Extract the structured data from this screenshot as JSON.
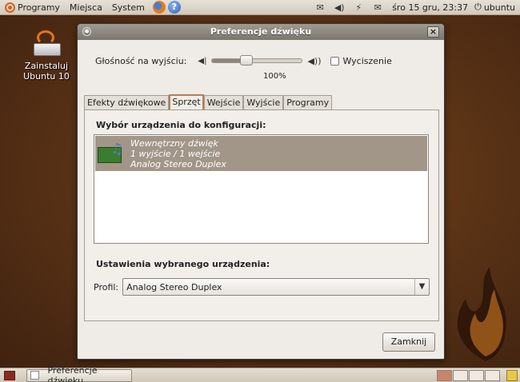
{
  "top_panel": {
    "menus": [
      "Programy",
      "Miejsca",
      "System"
    ],
    "clock": "śro 15 gru, 23:37",
    "user": "ubuntu"
  },
  "desktop": {
    "install_icon_label": "Zainstaluj Ubuntu 10"
  },
  "window": {
    "title": "Preferencje dźwięku",
    "volume": {
      "label": "Głośność na wyjściu:",
      "value": 100,
      "percent_text": "100%",
      "mute_label": "Wyciszenie",
      "muted": false
    },
    "tabs": [
      {
        "label": "Efekty dźwiękowe",
        "active": false
      },
      {
        "label": "Sprzęt",
        "active": true
      },
      {
        "label": "Wejście",
        "active": false
      },
      {
        "label": "Wyjście",
        "active": false
      },
      {
        "label": "Programy",
        "active": false
      }
    ],
    "device_section_title": "Wybór urządzenia do konfiguracji:",
    "devices": [
      {
        "name": "Wewnętrzny dźwięk",
        "channels": "1 wyjście / 1 wejście",
        "profile": "Analog Stereo Duplex",
        "selected": true
      }
    ],
    "settings_section_title": "Ustawienia wybranego urządzenia:",
    "profile_label": "Profil:",
    "profile_value": "Analog Stereo Duplex",
    "close_button": "Zamknij"
  },
  "bottom_panel": {
    "task": "Preferencje dźwięku"
  },
  "colors": {
    "selection": "#a19688",
    "accent": "#e07b39",
    "desktop": "#5c3416"
  }
}
